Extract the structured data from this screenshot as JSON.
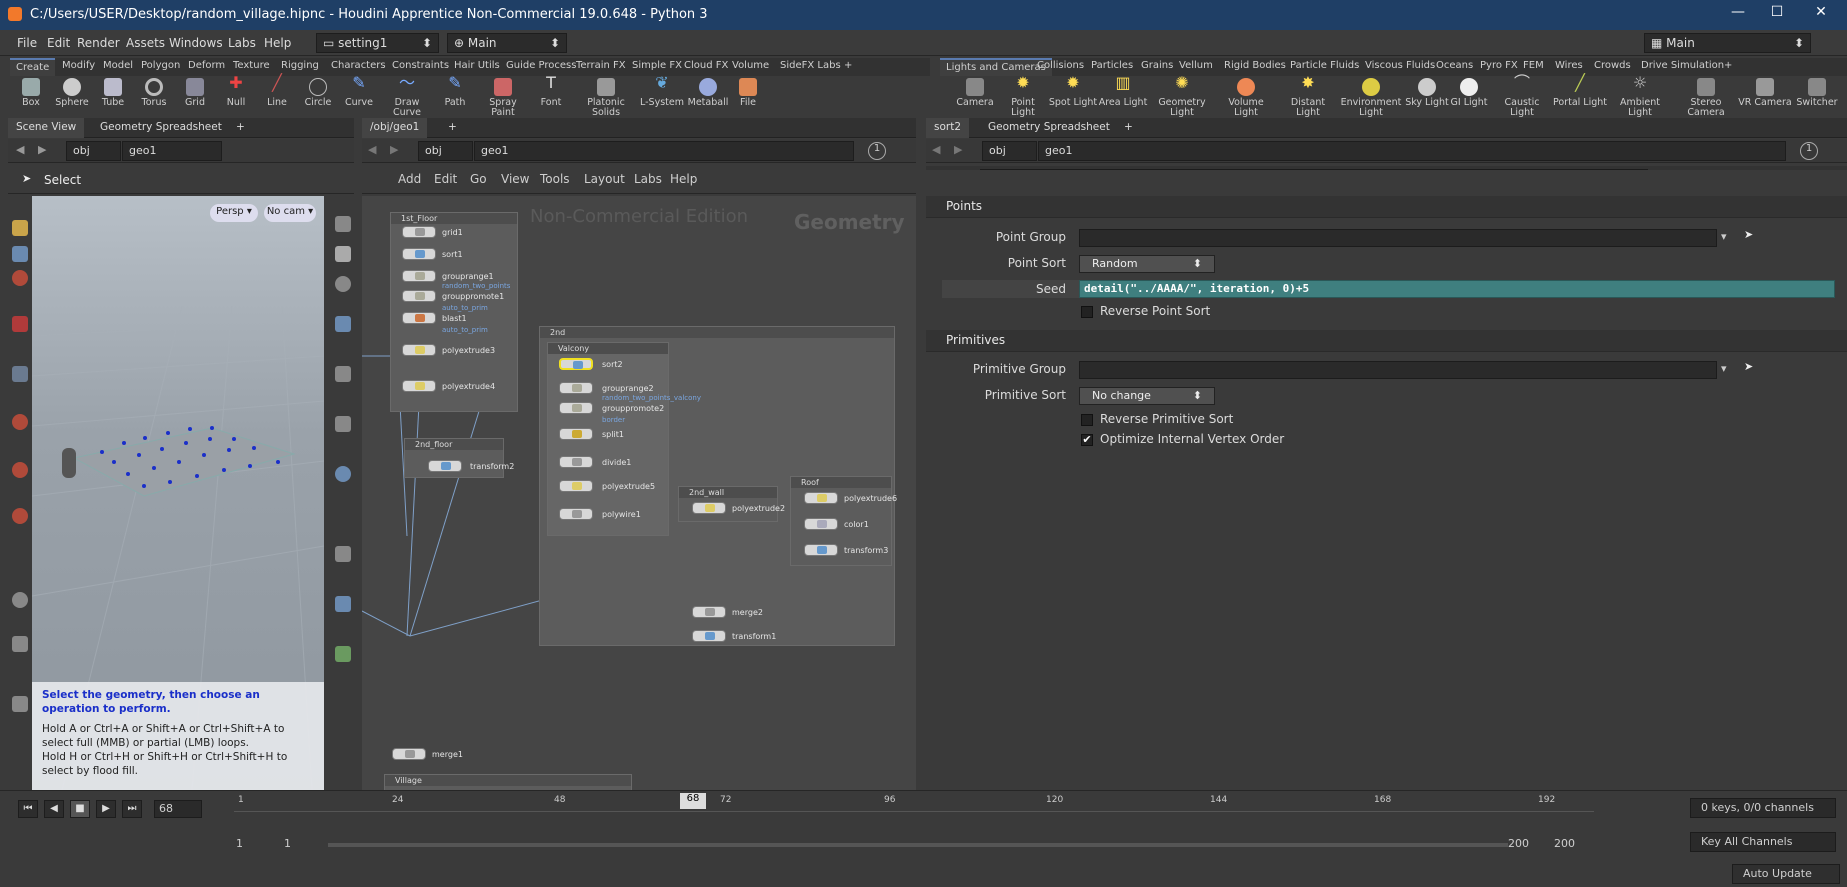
{
  "window": {
    "title": "C:/Users/USER/Desktop/random_village.hipnc - Houdini Apprentice Non-Commercial 19.0.648 - Python 3",
    "min": "—",
    "max": "☐",
    "close": "✕"
  },
  "menu": [
    "File",
    "Edit",
    "Render",
    "Assets",
    "Windows",
    "Labs",
    "Help"
  ],
  "desktop": "setting1",
  "context": "Main",
  "main_desktop": "Main",
  "left_shelf_tabs": [
    "Create",
    "Modify",
    "Model",
    "Polygon",
    "Deform",
    "Texture",
    "Rigging",
    "Characters",
    "Constraints",
    "Hair Utils",
    "Guide Process",
    "Terrain FX",
    "Simple FX",
    "Cloud FX",
    "Volume",
    "SideFX Labs"
  ],
  "left_tools": [
    "Box",
    "Sphere",
    "Tube",
    "Torus",
    "Grid",
    "Null",
    "Line",
    "Circle",
    "Curve",
    "Draw Curve",
    "Path",
    "Spray Paint",
    "Font",
    "Platonic Solids",
    "L-System",
    "Metaball",
    "File"
  ],
  "right_shelf_tabs": [
    "Lights and Cameras",
    "Collisions",
    "Particles",
    "Grains",
    "Vellum",
    "Rigid Bodies",
    "Particle Fluids",
    "Viscous Fluids",
    "Oceans",
    "Pyro FX",
    "FEM",
    "Wires",
    "Crowds",
    "Drive Simulation"
  ],
  "right_tools": [
    "Camera",
    "Point Light",
    "Spot Light",
    "Area Light",
    "Geometry Light",
    "Volume Light",
    "Distant Light",
    "Environment Light",
    "Sky Light",
    "GI Light",
    "Caustic Light",
    "Portal Light",
    "Ambient Light",
    "Stereo Camera",
    "VR Camera",
    "Switcher"
  ],
  "pane1": {
    "tabs": [
      "Scene View",
      "Geometry Spreadsheet"
    ],
    "path_obj": "obj",
    "path_geo": "geo1",
    "select": "Select",
    "persp": "Persp ▾",
    "cam": "No cam ▾",
    "hint_title": "Select the geometry, then choose an operation to perform.",
    "hint1": "Hold A or Ctrl+A or Shift+A or Ctrl+Shift+A to select full (MMB) or partial (LMB) loops.",
    "hint2": "Hold H or Ctrl+H or Shift+H or Ctrl+Shift+H to select by flood fill."
  },
  "pane2": {
    "tab": "/obj/geo1",
    "path_obj": "obj",
    "path_geo": "geo1",
    "menus": [
      "Add",
      "Edit",
      "Go",
      "View",
      "Tools",
      "Layout",
      "Labs",
      "Help"
    ],
    "watermark": "Non-Commercial Edition",
    "context_label": "Geometry",
    "pin": "1"
  },
  "network": {
    "boxes": [
      {
        "t": "1st_Floor"
      },
      {
        "t": "2nd"
      },
      {
        "t": "Valcony"
      },
      {
        "t": "2nd_floor"
      },
      {
        "t": "2nd_wall"
      },
      {
        "t": "Roof"
      },
      {
        "t": "Village"
      }
    ],
    "nodes": [
      "grid1",
      "sort1",
      "grouprange1",
      "grouppromote1",
      "blast1",
      "polyextrude3",
      "polyextrude4",
      "transform2",
      "sort2",
      "grouprange2",
      "grouppromote2",
      "split1",
      "divide1",
      "polyextrude5",
      "polywire1",
      "polyextrude2",
      "polyextrude6",
      "color1",
      "transform3",
      "merge2",
      "transform1",
      "merge1"
    ],
    "subs": [
      "random_two_points",
      "auto_to_prim",
      "auto_to_prim",
      "random_two_points_valcony",
      "border"
    ]
  },
  "pane3": {
    "tabs": [
      "sort2",
      "Geometry Spreadsheet"
    ],
    "path_obj": "obj",
    "path_geo": "geo1",
    "pin": "1",
    "op_type": "Sort",
    "op_name": "sort2"
  },
  "params": {
    "points": "Points",
    "point_group": "Point Group",
    "point_sort": "Point Sort",
    "point_sort_val": "Random",
    "seed": "Seed",
    "seed_val": "detail(\"../AAAA/\", iteration, 0)+5",
    "rev_point": "Reverse Point Sort",
    "prims": "Primitives",
    "prim_group": "Primitive Group",
    "prim_sort": "Primitive Sort",
    "prim_sort_val": "No change",
    "rev_prim": "Reverse Primitive Sort",
    "optimize": "Optimize Internal Vertex Order",
    "optimize_checked": true
  },
  "timeline": {
    "frame": "68",
    "ticks": [
      "1",
      "24",
      "48",
      "72",
      "96",
      "120",
      "144",
      "168",
      "192"
    ],
    "start1": "1",
    "start2": "1",
    "end1": "200",
    "end2": "200",
    "keys": "0 keys, 0/0 channels",
    "key_all": "Key All Channels",
    "auto_update": "Auto Update"
  },
  "colors": {
    "accent": "#5a7bb0",
    "title": "#1f3f66",
    "seed_bg": "#3f7f7f"
  }
}
